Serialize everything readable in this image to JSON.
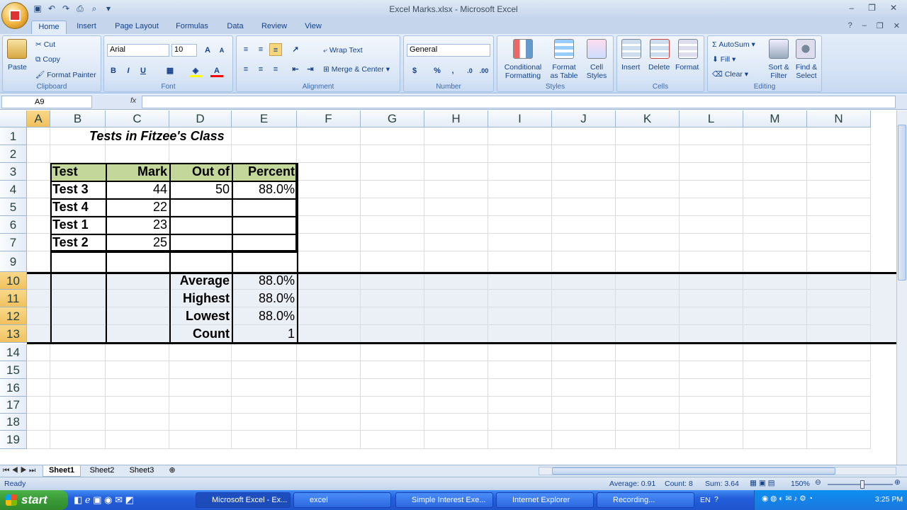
{
  "window": {
    "title": "Excel Marks.xlsx - Microsoft Excel"
  },
  "tabs": [
    "Home",
    "Insert",
    "Page Layout",
    "Formulas",
    "Data",
    "Review",
    "View"
  ],
  "ribbon": {
    "clipboard": {
      "label": "Clipboard",
      "paste": "Paste",
      "cut": "Cut",
      "copy": "Copy",
      "format_painter": "Format Painter"
    },
    "font": {
      "label": "Font",
      "name": "Arial",
      "size": "10"
    },
    "alignment": {
      "label": "Alignment",
      "wrap_text": "Wrap Text",
      "merge_center": "Merge & Center"
    },
    "number": {
      "label": "Number",
      "format": "General",
      "currency": "$",
      "percent": "%",
      "comma": ","
    },
    "styles": {
      "label": "Styles",
      "conditional": "Conditional",
      "conditional2": "Formatting",
      "format_as": "Format",
      "format_as2": "as Table",
      "cell": "Cell",
      "cell2": "Styles"
    },
    "cells": {
      "label": "Cells",
      "insert": "Insert",
      "delete": "Delete",
      "format": "Format"
    },
    "editing": {
      "label": "Editing",
      "autosum": "AutoSum",
      "fill": "Fill",
      "clear": "Clear",
      "sort": "Sort &",
      "sort2": "Filter",
      "find": "Find &",
      "find2": "Select"
    }
  },
  "formula_bar": {
    "name_box": "A9",
    "fx": "fx",
    "value": ""
  },
  "columns": [
    "A",
    "B",
    "C",
    "D",
    "E",
    "F",
    "G",
    "H",
    "I",
    "J",
    "K",
    "L",
    "M",
    "N"
  ],
  "rows": [
    "1",
    "2",
    "3",
    "4",
    "5",
    "6",
    "7",
    "9",
    "10",
    "11",
    "12",
    "13",
    "14",
    "15",
    "16",
    "17",
    "18",
    "19"
  ],
  "sheet": {
    "title": "Tests in Fitzee's Class",
    "headers": [
      "Test",
      "Mark",
      "Out of",
      "Percent"
    ],
    "data": [
      [
        "Test 3",
        "44",
        "50",
        "88.0%"
      ],
      [
        "Test 4",
        "22",
        "",
        ""
      ],
      [
        "Test 1",
        "23",
        "",
        ""
      ],
      [
        "Test 2",
        "25",
        "",
        ""
      ]
    ],
    "summary": [
      [
        "Average",
        "88.0%"
      ],
      [
        "Highest",
        "88.0%"
      ],
      [
        "Lowest",
        "88.0%"
      ],
      [
        "Count",
        "1"
      ]
    ]
  },
  "sheet_tabs": [
    "Sheet1",
    "Sheet2",
    "Sheet3"
  ],
  "status": {
    "ready": "Ready",
    "average": "Average: 0.91",
    "count": "Count: 8",
    "sum": "Sum: 3.64",
    "zoom": "150%"
  },
  "taskbar": {
    "start": "start",
    "tasks": [
      "Microsoft Excel - Ex...",
      "excel",
      "Simple Interest Exe...",
      "Internet Explorer",
      "Recording..."
    ],
    "lang": "EN",
    "time": "3:25 PM"
  },
  "colors": {
    "header_fill": "#c4d79b",
    "selection": "#e8ecf2",
    "accent": "#15428b"
  }
}
